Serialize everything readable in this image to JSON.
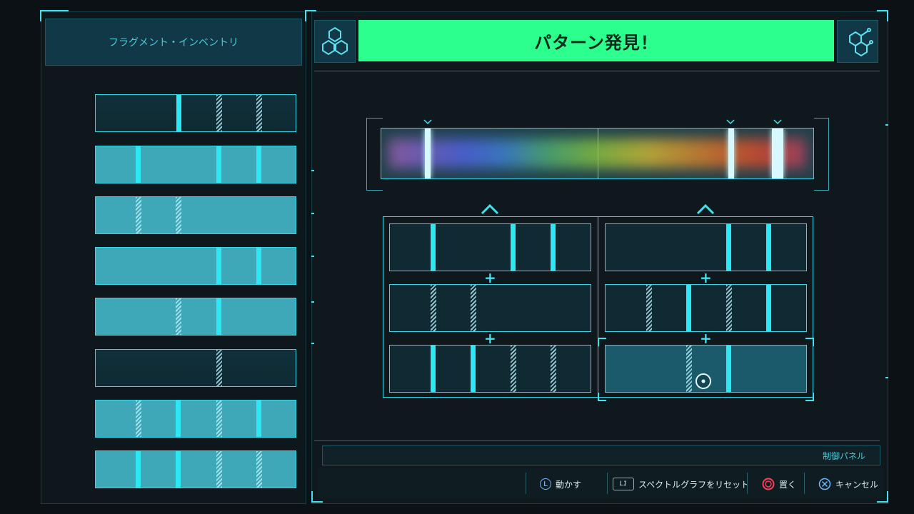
{
  "inventory": {
    "title": "フラグメント・インベントリ"
  },
  "banner": {
    "title": "パターン発見！"
  },
  "colors": {
    "accent": "#3fe3f0",
    "banner_green": "#2dff8e",
    "background": "#0b1114"
  },
  "icons": [
    "hexagon-molecule-icon",
    "caret-up-icon",
    "plus-icon",
    "cursor-icon"
  ],
  "fragments": [
    {
      "style": "dark"
    },
    {
      "style": "light"
    },
    {
      "style": "light"
    },
    {
      "style": "light"
    },
    {
      "style": "light"
    },
    {
      "style": "dark"
    },
    {
      "style": "light"
    },
    {
      "style": "light"
    }
  ],
  "control_panel": {
    "label": "制御パネル"
  },
  "hints": [
    {
      "button": "L",
      "label": "動かす"
    },
    {
      "button": "L1",
      "label": "スペクトルグラフをリセット"
    },
    {
      "button": "circle",
      "label": "置く"
    },
    {
      "button": "cross",
      "label": "キャンセル"
    }
  ]
}
